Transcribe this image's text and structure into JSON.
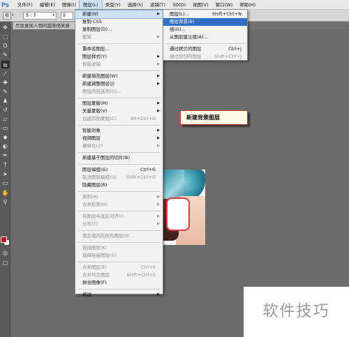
{
  "app": {
    "logo": "Ps"
  },
  "menubar": {
    "items": [
      {
        "label": "文件(F)"
      },
      {
        "label": "编辑(E)"
      },
      {
        "label": "图像(I)"
      },
      {
        "label": "图层(L)",
        "active": true
      },
      {
        "label": "类型(Y)"
      },
      {
        "label": "选择(S)"
      },
      {
        "label": "滤镜(T)"
      },
      {
        "label": "3D(D)"
      },
      {
        "label": "视图(V)"
      },
      {
        "label": "窗口(W)"
      },
      {
        "label": "帮助(H)"
      }
    ]
  },
  "options_bar": {
    "tool_icon": "crop-icon",
    "style_label": "▾",
    "ratio_value": "5 : 7",
    "field_value": "5"
  },
  "document_tab": {
    "title": "尽显复现人物的甜美俏笑质"
  },
  "toolbar": {
    "tools": [
      {
        "name": "move-tool-icon",
        "glyph": "✥"
      },
      {
        "name": "marquee-tool-icon",
        "glyph": "⬚"
      },
      {
        "name": "lasso-tool-icon",
        "glyph": "ʘ"
      },
      {
        "name": "quick-select-tool-icon",
        "glyph": "✎"
      },
      {
        "name": "crop-tool-icon",
        "glyph": "⧉",
        "active": true
      },
      {
        "name": "eyedropper-tool-icon",
        "glyph": "⁄"
      },
      {
        "name": "healing-tool-icon",
        "glyph": "✚"
      },
      {
        "name": "brush-tool-icon",
        "glyph": "✎"
      },
      {
        "name": "stamp-tool-icon",
        "glyph": "♟"
      },
      {
        "name": "history-brush-tool-icon",
        "glyph": "↺"
      },
      {
        "name": "eraser-tool-icon",
        "glyph": "▱"
      },
      {
        "name": "gradient-tool-icon",
        "glyph": "▭"
      },
      {
        "name": "blur-tool-icon",
        "glyph": "◆"
      },
      {
        "name": "dodge-tool-icon",
        "glyph": "◐"
      },
      {
        "name": "pen-tool-icon",
        "glyph": "✒"
      },
      {
        "name": "type-tool-icon",
        "glyph": "T"
      },
      {
        "name": "path-select-tool-icon",
        "glyph": "➤"
      },
      {
        "name": "shape-tool-icon",
        "glyph": "▭"
      },
      {
        "name": "hand-tool-icon",
        "glyph": "✋"
      },
      {
        "name": "zoom-tool-icon",
        "glyph": "⚲"
      }
    ],
    "extra_tools": [
      {
        "name": "quick-mask-icon",
        "glyph": "◎"
      },
      {
        "name": "screen-mode-icon",
        "glyph": "▢"
      }
    ],
    "colors": {
      "foreground": "#d0131c",
      "background": "#ffffff"
    }
  },
  "layer_menu": {
    "rows": [
      {
        "label": "新建(N)",
        "arrow": true,
        "hl": true
      },
      {
        "label": "复制 CSS"
      },
      {
        "label": "复制图层(D)..."
      },
      {
        "label": "删除",
        "arrow": true,
        "disabled": true
      },
      {
        "sep": true
      },
      {
        "label": "重命名图层..."
      },
      {
        "label": "图层样式(Y)",
        "arrow": true
      },
      {
        "label": "智能滤镜",
        "arrow": true,
        "disabled": true
      },
      {
        "sep": true
      },
      {
        "label": "新建填充图层(W)",
        "arrow": true
      },
      {
        "label": "新建调整图层(J)",
        "arrow": true
      },
      {
        "label": "图层内容选项(O)...",
        "disabled": true
      },
      {
        "sep": true
      },
      {
        "label": "图层蒙版(M)",
        "arrow": true
      },
      {
        "label": "矢量蒙版(V)",
        "arrow": true
      },
      {
        "label": "创建剪贴蒙版(C)",
        "shortcut": "Alt+Ctrl+G",
        "disabled": true
      },
      {
        "sep": true
      },
      {
        "label": "智能对象",
        "arrow": true
      },
      {
        "label": "视频图层",
        "arrow": true
      },
      {
        "label": "栅格化(Z)",
        "arrow": true,
        "disabled": true
      },
      {
        "sep": true
      },
      {
        "label": "新建基于图层的切片(B)"
      },
      {
        "sep": true
      },
      {
        "label": "图层编组(G)",
        "shortcut": "Ctrl+G"
      },
      {
        "label": "取消图层编组(U)",
        "shortcut": "Shift+Ctrl+G",
        "disabled": true
      },
      {
        "label": "隐藏图层(R)"
      },
      {
        "sep": true
      },
      {
        "label": "排列(A)",
        "arrow": true,
        "disabled": true
      },
      {
        "label": "合并形状(H)",
        "arrow": true,
        "disabled": true
      },
      {
        "sep": true
      },
      {
        "label": "将图层与选区对齐(I)",
        "arrow": true,
        "disabled": true
      },
      {
        "label": "分布(T)",
        "arrow": true,
        "disabled": true
      },
      {
        "sep": true
      },
      {
        "label": "锁定组内的所有图层(X)...",
        "disabled": true
      },
      {
        "sep": true
      },
      {
        "label": "链接图层(K)",
        "disabled": true
      },
      {
        "label": "选择链接图层(S)",
        "disabled": true
      },
      {
        "sep": true
      },
      {
        "label": "合并图层(E)",
        "shortcut": "Ctrl+E",
        "disabled": true
      },
      {
        "label": "合并可见图层",
        "shortcut": "Shift+Ctrl+E",
        "disabled": true
      },
      {
        "label": "拼合图像(F)"
      },
      {
        "sep": true
      },
      {
        "label": "修边",
        "arrow": true
      }
    ]
  },
  "new_submenu": {
    "rows": [
      {
        "label": "图层(L)...",
        "shortcut": "Shift+Ctrl+N"
      },
      {
        "label": "图层背景(B)",
        "selected": true
      },
      {
        "label": "组(G)..."
      },
      {
        "label": "从图层建立组(A)..."
      },
      {
        "sep": true
      },
      {
        "label": "通过拷贝的图层",
        "shortcut": "Ctrl+J"
      },
      {
        "label": "通过剪切的图层",
        "shortcut": "Shift+Ctrl+J",
        "disabled": true
      }
    ]
  },
  "callout": {
    "text": "新建背景图层"
  },
  "watermark": {
    "text": "软件技巧"
  }
}
